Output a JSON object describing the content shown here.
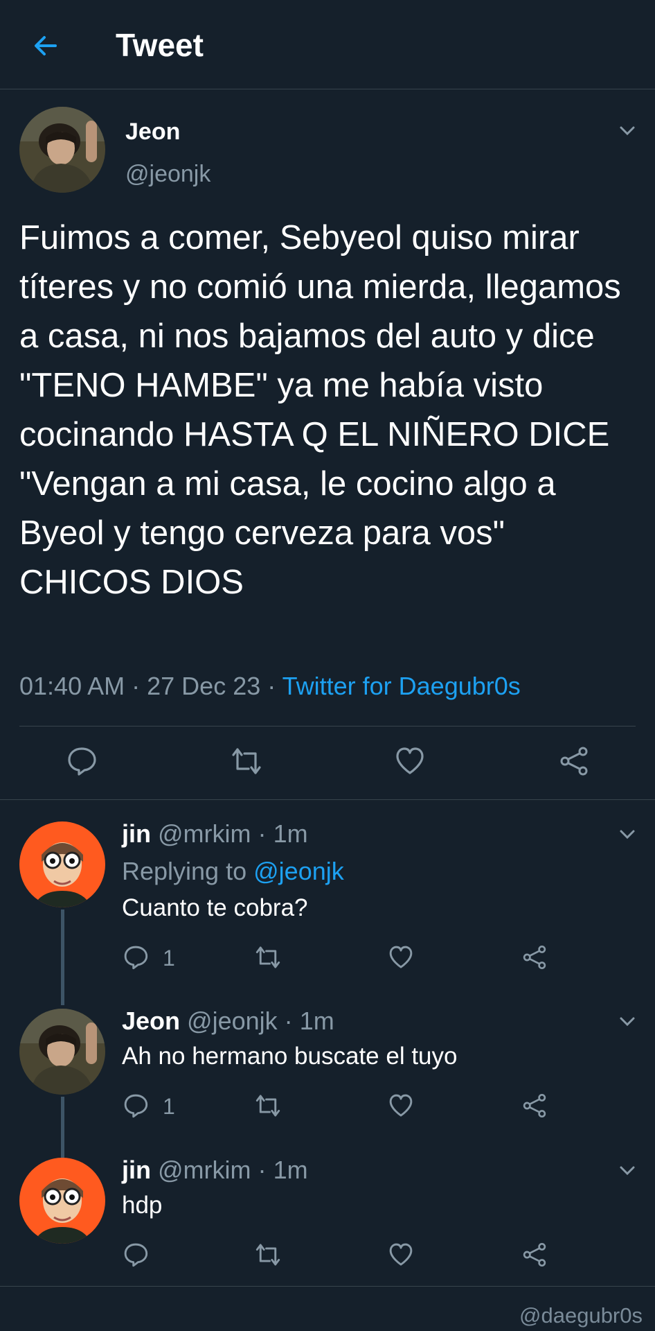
{
  "header": {
    "title": "Tweet",
    "back_icon": "arrow-left-icon"
  },
  "colors": {
    "background": "#15202b",
    "accent": "#1da1f2",
    "muted": "#8899a6",
    "divider": "#38444d"
  },
  "main_tweet": {
    "author_name": "Jeon",
    "author_handle": "@jeonjk",
    "text": "Fuimos a comer, Sebyeol quiso mirar títeres y no comió una mierda, llegamos a casa, ni nos bajamos del auto y dice \"TENO HAMBE\" ya me había visto cocinando HASTA Q EL NIÑERO DICE \"Vengan a mi casa, le cocino algo a Byeol y tengo cerveza para vos\" CHICOS DIOS",
    "time": "01:40 AM",
    "date": "27 Dec 23",
    "separator": "·",
    "source": "Twitter for Daegubr0s",
    "actions": [
      "reply-icon",
      "retweet-icon",
      "like-icon",
      "share-icon"
    ]
  },
  "replies": [
    {
      "name": "jin",
      "handle": "@mrkim",
      "time": "1m",
      "replying_prefix": "Replying to",
      "replying_to": "@jeonjk",
      "text": "Cuanto te cobra?",
      "reply_count": "1"
    },
    {
      "name": "Jeon",
      "handle": "@jeonjk",
      "time": "1m",
      "text": "Ah no hermano buscate el tuyo",
      "reply_count": "1"
    },
    {
      "name": "jin",
      "handle": "@mrkim",
      "time": "1m",
      "text": "hdp",
      "reply_count": ""
    }
  ],
  "watermark": "@daegubr0s"
}
